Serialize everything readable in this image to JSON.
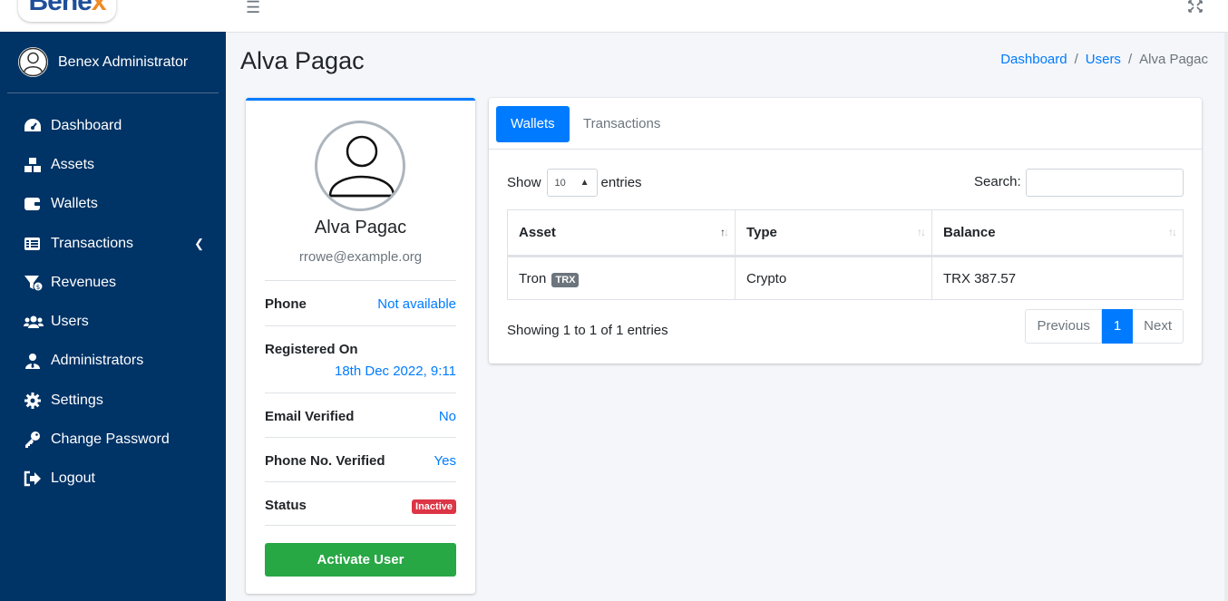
{
  "brand": {
    "name_main": "Bene",
    "name_accent": "x"
  },
  "sidebar": {
    "user_name": "Benex Administrator",
    "items": [
      {
        "label": "Dashboard",
        "icon": "tachometer-icon"
      },
      {
        "label": "Assets",
        "icon": "cubes-icon"
      },
      {
        "label": "Wallets",
        "icon": "wallet-icon"
      },
      {
        "label": "Transactions",
        "icon": "list-icon"
      },
      {
        "label": "Revenues",
        "icon": "funnel-dollar-icon"
      },
      {
        "label": "Users",
        "icon": "users-icon"
      },
      {
        "label": "Administrators",
        "icon": "user-tie-icon"
      },
      {
        "label": "Settings",
        "icon": "gear-icon"
      },
      {
        "label": "Change Password",
        "icon": "key-icon"
      },
      {
        "label": "Logout",
        "icon": "sign-out-icon"
      }
    ]
  },
  "page": {
    "title": "Alva Pagac",
    "breadcrumb": [
      "Dashboard",
      "Users",
      "Alva Pagac"
    ]
  },
  "profile": {
    "name": "Alva Pagac",
    "email": "rrowe@example.org",
    "rows": {
      "phone_label": "Phone",
      "phone_value": "Not available",
      "registered_label": "Registered On",
      "registered_value": "18th Dec 2022, 9:11",
      "email_verified_label": "Email Verified",
      "email_verified_value": "No",
      "phone_verified_label": "Phone No. Verified",
      "phone_verified_value": "Yes",
      "status_label": "Status",
      "status_value": "Inactive"
    },
    "activate_label": "Activate User"
  },
  "tabs": [
    "Wallets",
    "Transactions"
  ],
  "table_controls": {
    "show_label": "Show",
    "entries_value": "10",
    "entries_label": "entries",
    "search_label": "Search:"
  },
  "table": {
    "headers": [
      "Asset",
      "Type",
      "Balance"
    ],
    "rows": [
      {
        "asset": "Tron",
        "ticker": "TRX",
        "type": "Crypto",
        "balance": "TRX 387.57"
      }
    ],
    "info": "Showing 1 to 1 of 1 entries",
    "pager": {
      "previous": "Previous",
      "current": "1",
      "next": "Next"
    }
  },
  "colors": {
    "sidebar": "#003366",
    "primary": "#007bff",
    "success": "#28a745",
    "danger": "#dc3545"
  }
}
